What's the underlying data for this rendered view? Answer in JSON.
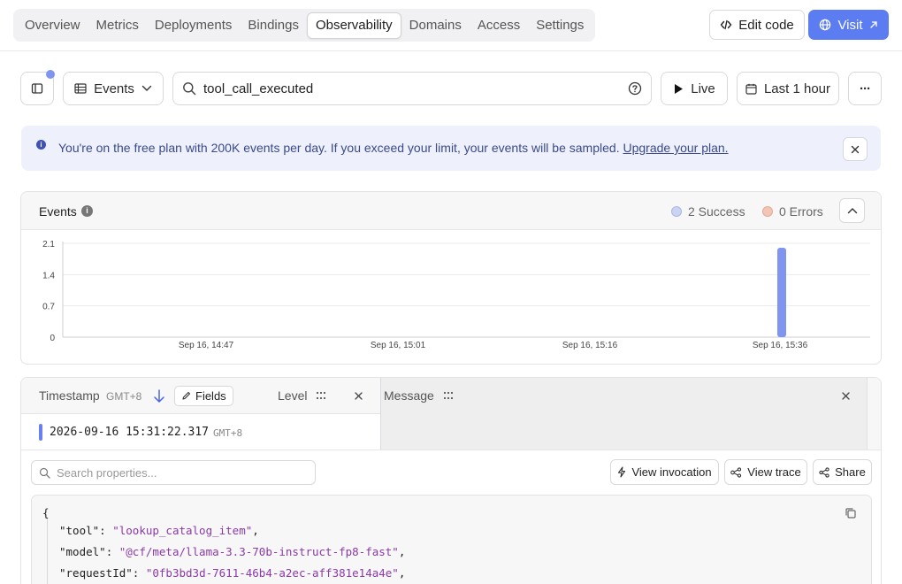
{
  "nav": {
    "tabs": [
      {
        "label": "Overview"
      },
      {
        "label": "Metrics"
      },
      {
        "label": "Deployments"
      },
      {
        "label": "Bindings"
      },
      {
        "label": "Observability"
      },
      {
        "label": "Domains"
      },
      {
        "label": "Access"
      },
      {
        "label": "Settings"
      }
    ],
    "active_tab": "Observability",
    "edit_code_label": "Edit code",
    "visit_label": "Visit"
  },
  "toolbar": {
    "view_selector": "Events",
    "search_value": "tool_call_executed",
    "live_label": "Live",
    "time_range": "Last 1 hour",
    "more_label": "···"
  },
  "banner": {
    "text": "You're on the free plan with 200K events per day. If you exceed your limit, your events will be sampled.",
    "link": "Upgrade your plan."
  },
  "events_card": {
    "title": "Events",
    "legend": [
      {
        "label": "2 Success",
        "color": "#c9d3f2"
      },
      {
        "label": "0 Errors",
        "color": "#f2c6b7"
      }
    ]
  },
  "chart_data": {
    "type": "bar",
    "yticks": [
      "2.1",
      "1.4",
      "0.7",
      "0"
    ],
    "ylim": [
      0,
      2.1
    ],
    "xticks": [
      "Sep 16, 14:47",
      "Sep 16, 15:01",
      "Sep 16, 15:16",
      "Sep 16, 15:36"
    ],
    "series": [
      {
        "name": "Success",
        "color": "#7f95ef",
        "points": [
          {
            "x": "Sep 16, 15:31",
            "y": 2
          }
        ]
      }
    ]
  },
  "table": {
    "columns": {
      "timestamp": "Timestamp",
      "timezone": "GMT+8",
      "fields_label": "Fields",
      "level": "Level",
      "message": "Message"
    },
    "rows": [
      {
        "timestamp": "2026-09-16 15:31:22.317",
        "tz": "GMT+8"
      }
    ],
    "detail": {
      "search_placeholder": "Search properties...",
      "view_invocation_label": "View invocation",
      "view_trace_label": "View trace",
      "share_label": "Share",
      "json_lines": [
        {
          "key": "\"tool\"",
          "value": "\"lookup_catalog_item\""
        },
        {
          "key": "\"model\"",
          "value": "\"@cf/meta/llama-3.3-70b-instruct-fp8-fast\""
        },
        {
          "key": "\"requestId\"",
          "value": "\"0fb3bd3d-7611-46b4-a2ec-aff381e14a4e\""
        }
      ]
    }
  }
}
